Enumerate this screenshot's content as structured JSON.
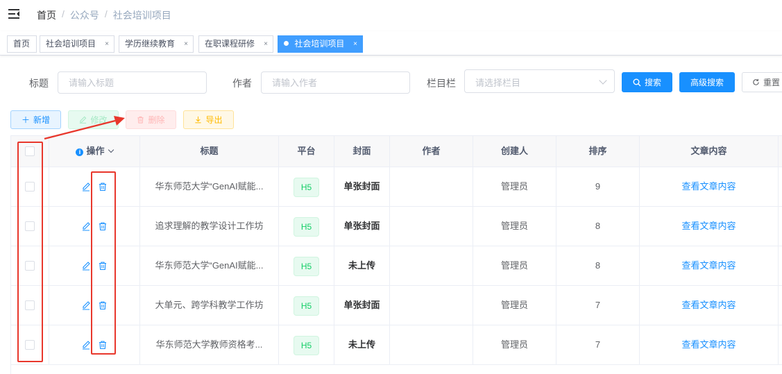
{
  "breadcrumb": {
    "home": "首页",
    "items": [
      "公众号",
      "社会培训项目"
    ],
    "sep": "/"
  },
  "tags": [
    {
      "label": "首页",
      "closable": false,
      "active": false
    },
    {
      "label": "社会培训项目",
      "closable": true,
      "active": false
    },
    {
      "label": "学历继续教育",
      "closable": true,
      "active": false
    },
    {
      "label": "在职课程研修",
      "closable": true,
      "active": false
    },
    {
      "label": "社会培训项目",
      "closable": true,
      "active": true
    }
  ],
  "tag_close": "×",
  "search": {
    "title_label": "标题",
    "title_placeholder": "请输入标题",
    "author_label": "作者",
    "author_placeholder": "请输入作者",
    "column_label": "栏目栏",
    "column_placeholder": "请选择栏目",
    "search_btn": "搜索",
    "advanced_btn": "高级搜索",
    "reset_btn": "重置"
  },
  "toolbar": {
    "add": "新增",
    "edit": "修改",
    "delete": "删除",
    "export": "导出"
  },
  "table": {
    "headers": {
      "ops": "操作",
      "title": "标题",
      "platform": "平台",
      "cover": "封面",
      "author": "作者",
      "creator": "创建人",
      "sort": "排序",
      "content": "文章内容"
    },
    "rows": [
      {
        "title": "华东师范大学“GenAI赋能...",
        "platform": "H5",
        "cover": "单张封面",
        "author": "",
        "creator": "管理员",
        "sort": "9",
        "content": "查看文章内容"
      },
      {
        "title": "追求理解的教学设计工作坊",
        "platform": "H5",
        "cover": "单张封面",
        "author": "",
        "creator": "管理员",
        "sort": "8",
        "content": "查看文章内容"
      },
      {
        "title": "华东师范大学“GenAI赋能...",
        "platform": "H5",
        "cover": "未上传",
        "author": "",
        "creator": "管理员",
        "sort": "8",
        "content": "查看文章内容"
      },
      {
        "title": "大单元、跨学科教学工作坊",
        "platform": "H5",
        "cover": "单张封面",
        "author": "",
        "creator": "管理员",
        "sort": "7",
        "content": "查看文章内容"
      },
      {
        "title": "华东师范大学教师资格考...",
        "platform": "H5",
        "cover": "未上传",
        "author": "",
        "creator": "管理员",
        "sort": "7",
        "content": "查看文章内容"
      }
    ]
  },
  "colors": {
    "primary": "#1890ff",
    "annotation": "#e8372c",
    "success": "#13ce66"
  }
}
